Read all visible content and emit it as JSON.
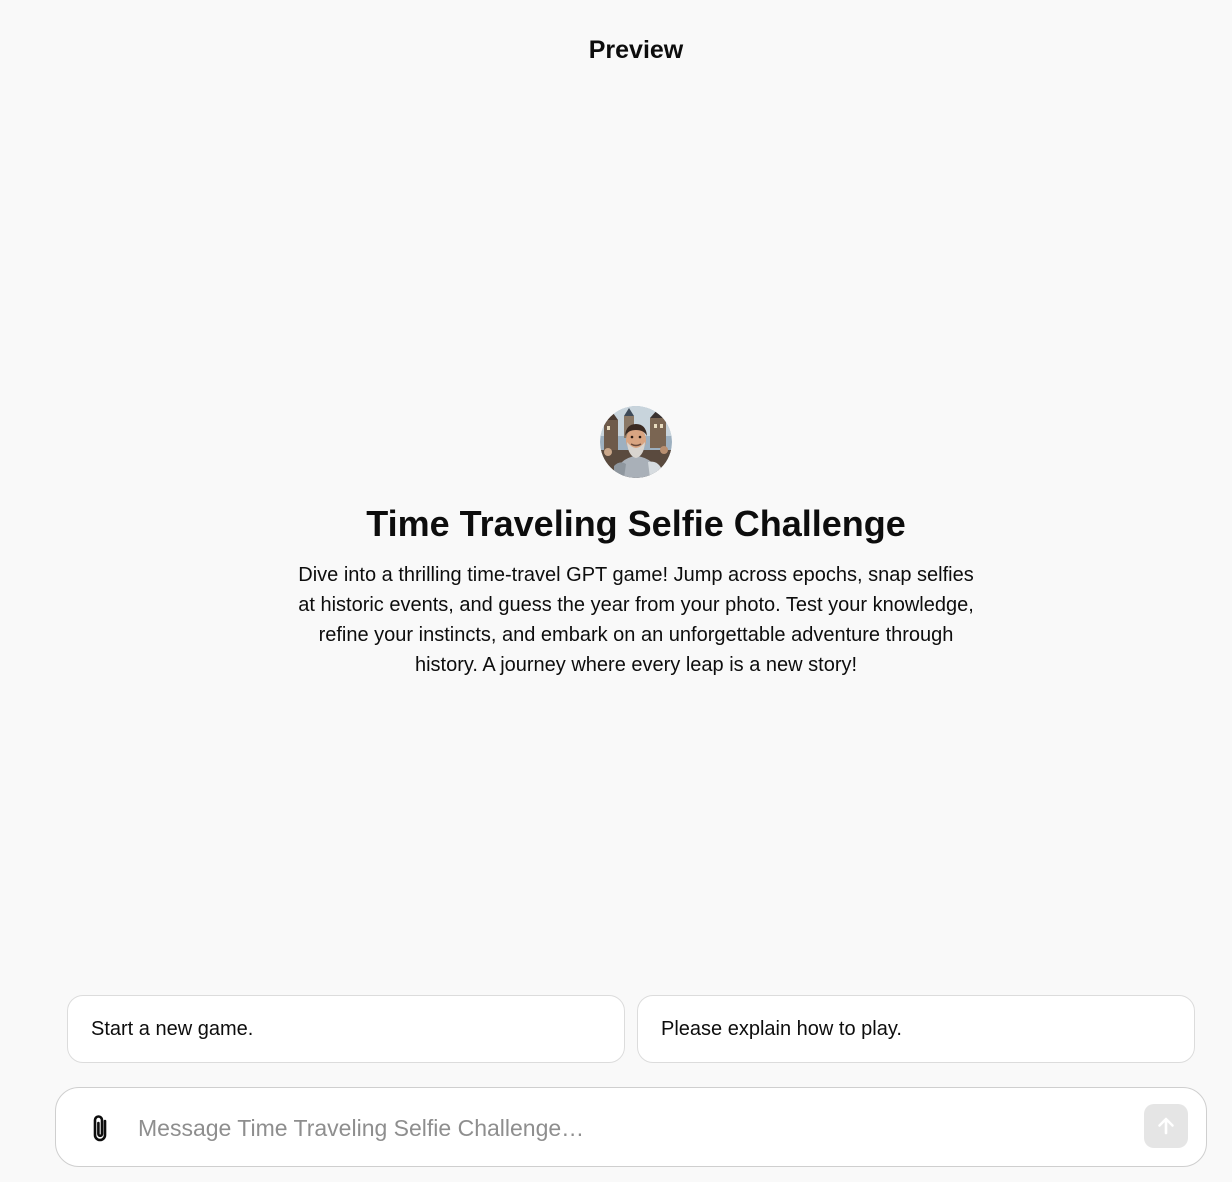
{
  "header": {
    "title": "Preview"
  },
  "gpt": {
    "avatar_icon": "knight-selfie-avatar",
    "name": "Time Traveling Selfie Challenge",
    "description": "Dive into a thrilling time-travel GPT game! Jump across epochs, snap selfies at historic events, and guess the year from your photo. Test your knowledge, refine your instincts, and embark on an unforgettable adventure through history. A journey where every leap is a new story!"
  },
  "starters": [
    {
      "label": "Start a new game."
    },
    {
      "label": "Please explain how to play."
    }
  ],
  "composer": {
    "placeholder": "Message Time Traveling Selfie Challenge…",
    "value": "",
    "attach_icon": "paperclip-icon",
    "send_icon": "arrow-up-icon"
  },
  "colors": {
    "background": "#f9f9f9",
    "text": "#0d0d0d",
    "placeholder": "#8e8e8e",
    "send_button_disabled": "#e5e5e5"
  }
}
